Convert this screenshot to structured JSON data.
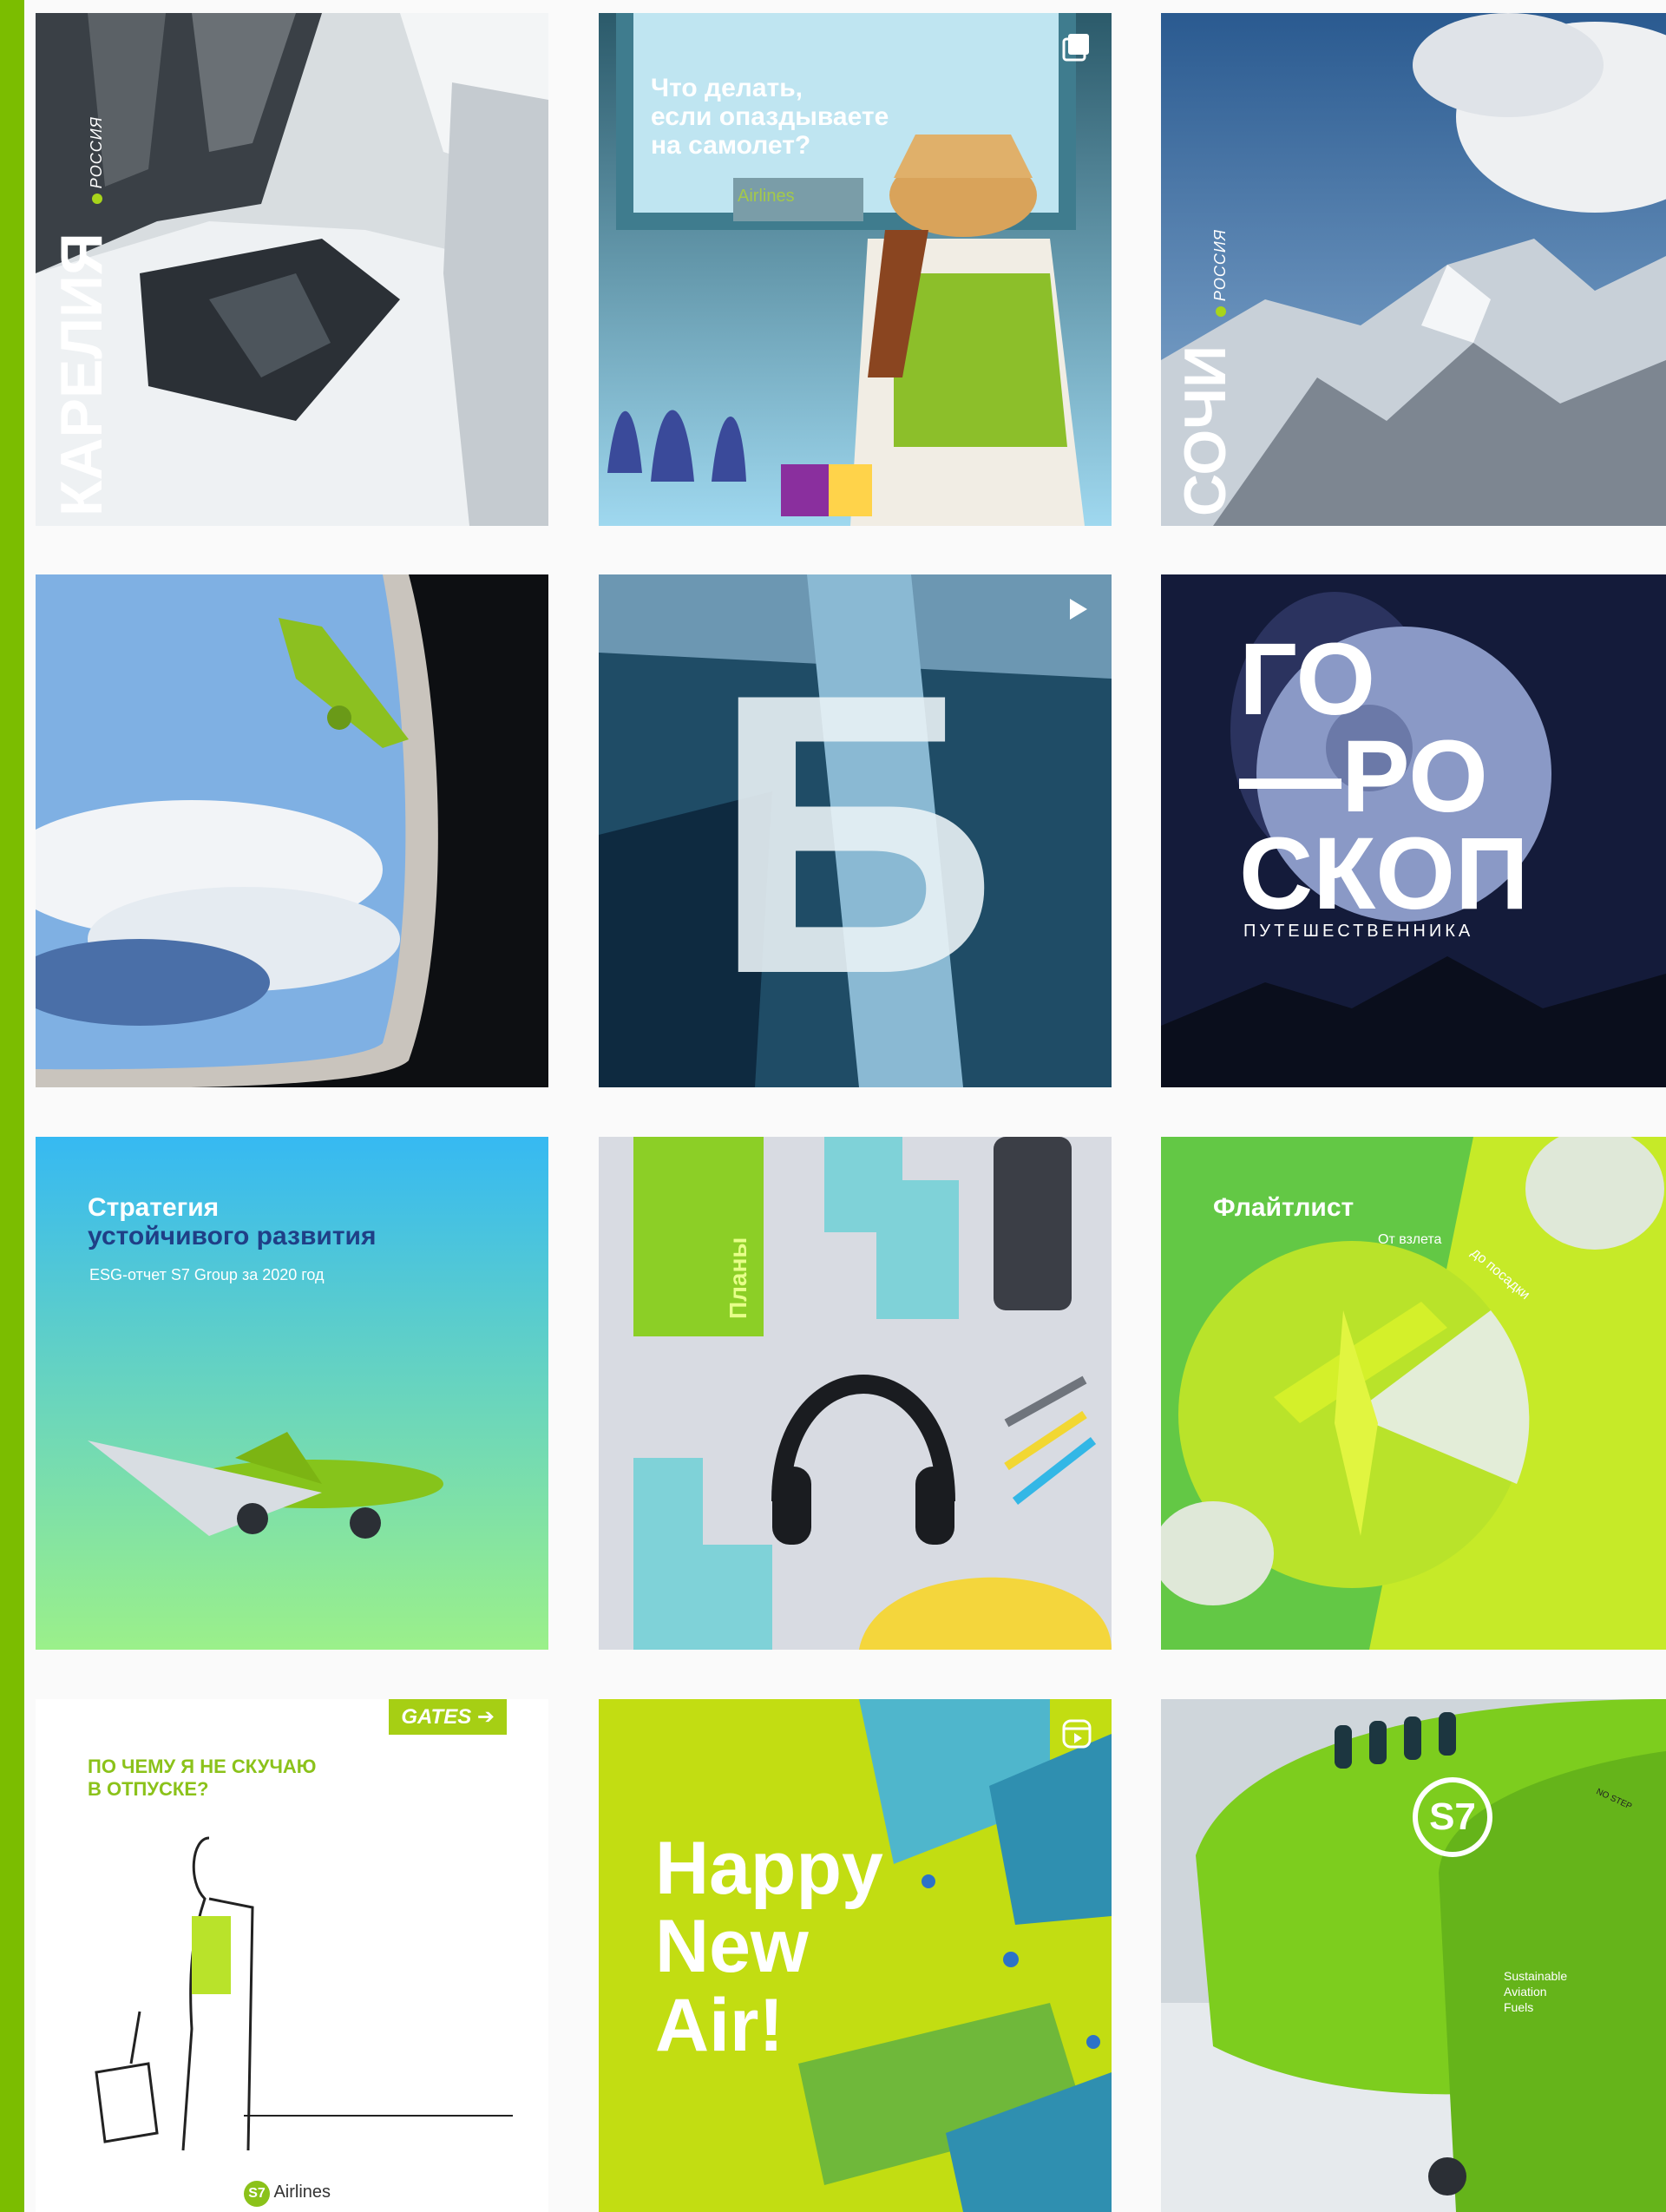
{
  "posts": [
    {
      "id": "karelia",
      "title": "КАРЕЛИЯ",
      "subtitle": "РОССИЯ"
    },
    {
      "id": "late",
      "headline_1": "Что делать,",
      "headline_2": "если опаздываете",
      "headline_3": "на самолет?",
      "badge": "Airlines",
      "icon": "multi-image-icon"
    },
    {
      "id": "sochi",
      "title": "СОЧИ",
      "subtitle": "РОССИЯ"
    },
    {
      "id": "window"
    },
    {
      "id": "ice-b",
      "letter": "Б",
      "icon": "video-play-icon"
    },
    {
      "id": "horoscope",
      "line_1": "ГО",
      "line_2": "—РО",
      "line_3": "СКОП",
      "caption": "ПУТЕШЕСТВЕННИКА"
    },
    {
      "id": "strategy",
      "line_1": "Стратегия",
      "line_2": "устойчивого развития",
      "caption": "ESG-отчет S7 Group за 2020 год"
    },
    {
      "id": "plans",
      "notebook_label": "Планы"
    },
    {
      "id": "flightlist",
      "title": "Флайтлист",
      "tag_1": "От взлета",
      "tag_2": "до посадки"
    },
    {
      "id": "gates",
      "badge": "GATES",
      "question_1": "ПО ЧЕМУ Я НЕ СКУЧАЮ",
      "question_2": "В ОТПУСКЕ?",
      "logo": "Airlines"
    },
    {
      "id": "newair",
      "line_1": "Happy",
      "line_2": "New",
      "line_3": "Air!",
      "icon": "reels-icon"
    },
    {
      "id": "plane",
      "fuel_1": "Sustainable",
      "fuel_2": "Aviation",
      "fuel_3": "Fuels",
      "sign": "NO STEP"
    }
  ],
  "colors": {
    "brand_green": "#7bbd00",
    "lime": "#c8e000"
  }
}
